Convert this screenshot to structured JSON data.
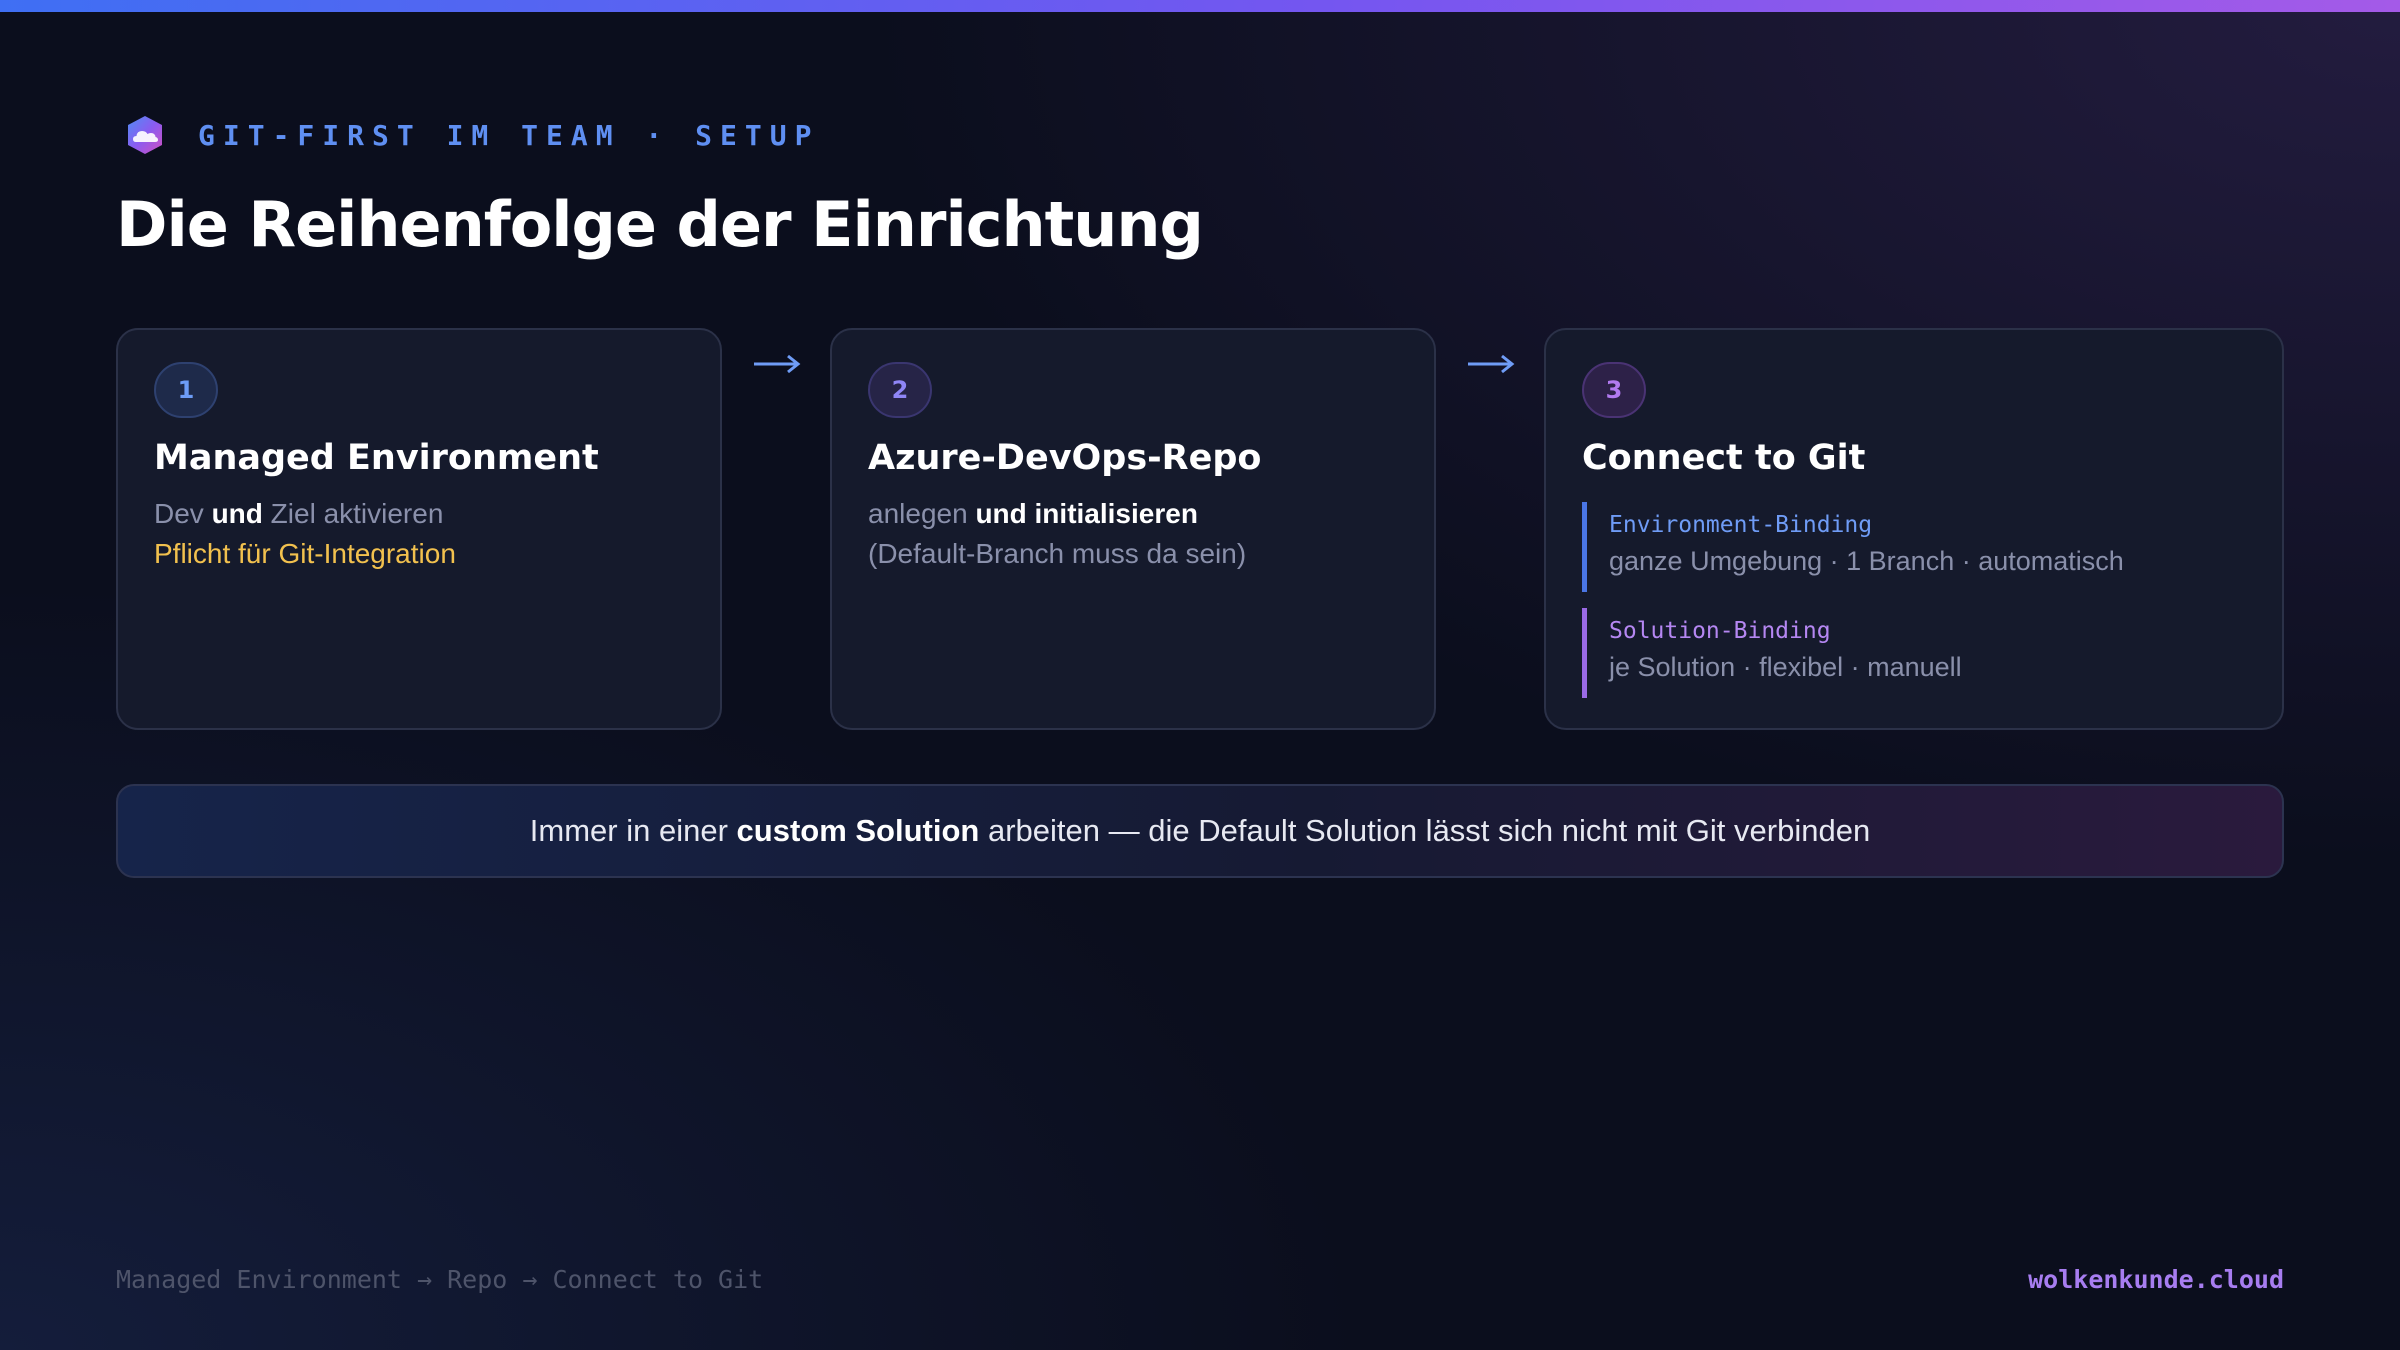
{
  "header": {
    "eyebrow": "GIT-FIRST IM TEAM · SETUP",
    "title": "Die Reihenfolge der Einrichtung",
    "logo_icon": "cloud-logo-icon"
  },
  "steps": [
    {
      "number": "1",
      "title": "Managed Environment",
      "line1": {
        "pre": "Dev ",
        "bold": "und",
        "post": " Ziel aktivieren"
      },
      "line2": "Pflicht für Git-Integration"
    },
    {
      "number": "2",
      "title": "Azure-DevOps-Repo",
      "line1": {
        "pre": "anlegen ",
        "bold": "und initialisieren"
      },
      "line2": "(Default-Branch muss da sein)"
    },
    {
      "number": "3",
      "title": "Connect to Git",
      "bindings": [
        {
          "name": "Environment-Binding",
          "description": "ganze Umgebung · 1 Branch · automatisch"
        },
        {
          "name": "Solution-Binding",
          "description": "je Solution · flexibel · manuell"
        }
      ]
    }
  ],
  "arrows": {
    "icon": "arrow-right-icon"
  },
  "callout": {
    "pre": "Immer in einer ",
    "bold": "custom Solution",
    "post": " arbeiten — die Default Solution lässt sich nicht mit Git verbinden"
  },
  "footer": {
    "breadcrumb": "Managed Environment → Repo → Connect to Git",
    "brand": "wolkenkunde.cloud"
  },
  "colors": {
    "background": "#0b0e1d",
    "card": "#151a2c",
    "accent_blue": "#5f8ff2",
    "accent_purple": "#a77df0",
    "warning": "#f2c14e"
  }
}
